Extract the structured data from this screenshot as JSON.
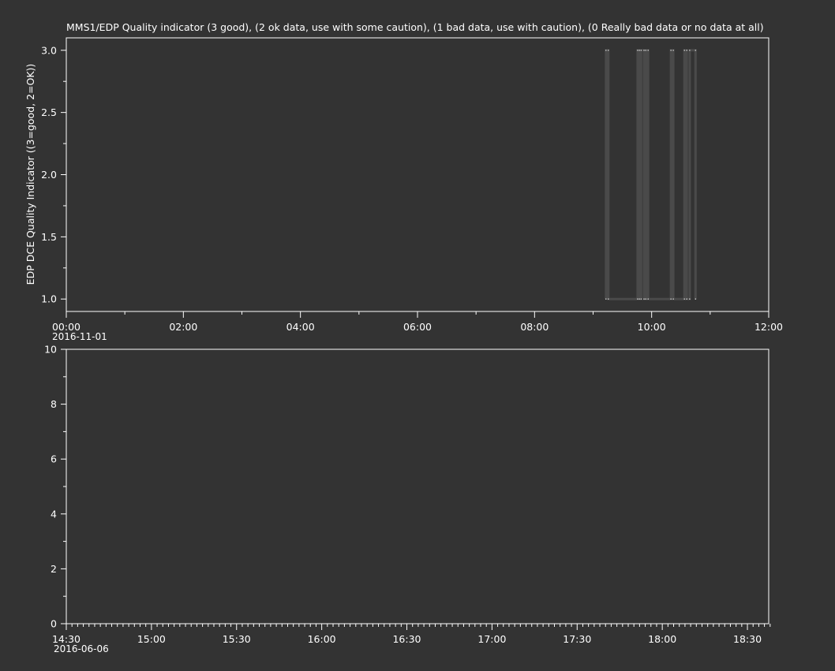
{
  "window": {
    "background": "#333333",
    "foreground": "#ffffff",
    "series_color": "#4a4a4a"
  },
  "chart_data": [
    {
      "type": "line",
      "title": "MMS1/EDP  Quality indicator (3 good), (2 ok data, use with some caution), (1 bad data, use with caution), (0 Really bad data or no data at all)",
      "ylabel": "EDP DCE Quality Indicator ((3=good, 2=OK))",
      "xlabel": "",
      "date_label": "2016-11-01",
      "x_unit": "hours since 2016-11-01 00:00",
      "xlim": [
        0,
        12
      ],
      "ylim": [
        0.9,
        3.1
      ],
      "x_tick_labels": [
        "00:00",
        "02:00",
        "04:00",
        "06:00",
        "08:00",
        "10:00",
        "12:00"
      ],
      "x_tick_values": [
        0,
        2,
        4,
        6,
        8,
        10,
        12
      ],
      "x_minor_step": 1,
      "y_tick_labels": [
        "1.0",
        "1.5",
        "2.0",
        "2.5",
        "3.0"
      ],
      "y_tick_values": [
        1.0,
        1.5,
        2.0,
        2.5,
        3.0
      ],
      "y_minor_step": 0.25,
      "grid": false,
      "series": [
        {
          "values_note": "quality flag toggling between 1 and 3",
          "x": [
            9.22,
            9.22,
            9.26,
            9.26,
            9.76,
            9.76,
            9.79,
            9.79,
            9.82,
            9.82,
            9.87,
            9.87,
            9.9,
            9.9,
            9.94,
            9.94,
            10.33,
            10.33,
            10.37,
            10.37,
            10.56,
            10.56,
            10.6,
            10.6,
            10.65,
            10.65,
            10.75,
            10.75
          ],
          "y": [
            1,
            3,
            3,
            1,
            1,
            3,
            3,
            1,
            1,
            3,
            3,
            1,
            1,
            3,
            3,
            1,
            1,
            3,
            3,
            1,
            1,
            3,
            3,
            1,
            1,
            3,
            3,
            1
          ]
        }
      ]
    },
    {
      "type": "line",
      "title": "",
      "ylabel": "",
      "xlabel": "",
      "date_label": "2016-06-06",
      "x_unit": "hours since 2016-06-06 00:00",
      "xlim": [
        14.5,
        18.625
      ],
      "ylim": [
        0,
        10
      ],
      "x_tick_labels": [
        "14:30",
        "15:00",
        "15:30",
        "16:00",
        "16:30",
        "17:00",
        "17:30",
        "18:00",
        "18:30"
      ],
      "x_tick_values": [
        14.5,
        15.0,
        15.5,
        16.0,
        16.5,
        17.0,
        17.5,
        18.0,
        18.5
      ],
      "x_minor_step_minutes": 2,
      "y_tick_labels": [
        "0",
        "2",
        "4",
        "6",
        "8",
        "10"
      ],
      "y_tick_values": [
        0,
        2,
        4,
        6,
        8,
        10
      ],
      "y_minor_step": 1,
      "grid": false,
      "series": []
    }
  ]
}
